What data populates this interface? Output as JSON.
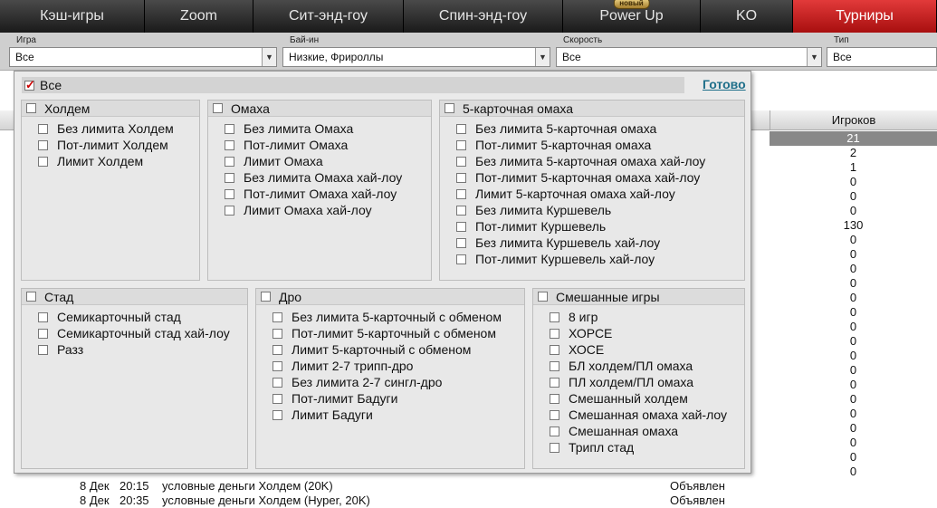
{
  "tabs": [
    {
      "label": "Кэш-игры",
      "active": false
    },
    {
      "label": "Zoom",
      "active": false
    },
    {
      "label": "Сит-энд-гоу",
      "active": false
    },
    {
      "label": "Спин-энд-гоу",
      "active": false
    },
    {
      "label": "Power Up",
      "active": false,
      "badge": "новый"
    },
    {
      "label": "KO",
      "active": false
    },
    {
      "label": "Турниры",
      "active": true
    }
  ],
  "filters": {
    "game": {
      "label": "Игра",
      "value": "Все"
    },
    "buyin": {
      "label": "Бай-ин",
      "value": "Низкие, Фрироллы"
    },
    "speed": {
      "label": "Скорость",
      "value": "Все"
    },
    "type": {
      "label": "Тип",
      "value": "Все"
    }
  },
  "table": {
    "players_header": "Игроков",
    "players": [
      "21",
      "2",
      "1",
      "0",
      "0",
      "0",
      "130",
      "0",
      "0",
      "0",
      "0",
      "0",
      "0",
      "0",
      "0",
      "0",
      "0",
      "0",
      "0",
      "0",
      "0",
      "0",
      "0",
      "0"
    ],
    "rows": [
      {
        "date": "8 Дек",
        "time": "20:15",
        "name": "условные деньги Холдем (20K)",
        "status": "Объявлен",
        "players": "0"
      },
      {
        "date": "8 Дек",
        "time": "20:35",
        "name": "условные деньги Холдем (Hyper, 20K)",
        "status": "Объявлен",
        "players": "0"
      }
    ]
  },
  "panel": {
    "all_label": "Все",
    "done_label": "Готово",
    "groups": {
      "holdem": {
        "title": "Холдем",
        "items": [
          "Без лимита Холдем",
          "Пот-лимит Холдем",
          "Лимит Холдем"
        ]
      },
      "omaha": {
        "title": "Омаха",
        "items": [
          "Без лимита Омаха",
          "Пот-лимит Омаха",
          "Лимит Омаха",
          "Без лимита Омаха хай-лоу",
          "Пот-лимит Омаха хай-лоу",
          "Лимит Омаха хай-лоу"
        ]
      },
      "omaha5": {
        "title": "5-карточная омаха",
        "items": [
          "Без лимита 5-карточная омаха",
          "Пот-лимит 5-карточная омаха",
          "Без лимита 5-карточная омаха хай-лоу",
          "Пот-лимит 5-карточная омаха хай-лоу",
          "Лимит 5-карточная омаха хай-лоу",
          "Без лимита Куршевель",
          "Пот-лимит Куршевель",
          "Без лимита Куршевель хай-лоу",
          "Пот-лимит Куршевель хай-лоу"
        ]
      },
      "stud": {
        "title": "Стад",
        "items": [
          "Семикарточный стад",
          "Семикарточный стад хай-лоу",
          "Разз"
        ]
      },
      "draw": {
        "title": "Дро",
        "items": [
          "Без лимита 5-карточный с обменом",
          "Пот-лимит 5-карточный с обменом",
          "Лимит 5-карточный с обменом",
          "Лимит 2-7 трипп-дро",
          "Без лимита 2-7 сингл-дро",
          "Пот-лимит Бадуги",
          "Лимит Бадуги"
        ]
      },
      "mixed": {
        "title": "Смешанные игры",
        "items": [
          "8 игр",
          "ХОРСЕ",
          "ХОСЕ",
          "БЛ холдем/ПЛ омаха",
          "ПЛ холдем/ПЛ омаха",
          "Смешанный холдем",
          "Смешанная омаха хай-лоу",
          "Смешанная омаха",
          "Трипл стад"
        ]
      }
    }
  }
}
